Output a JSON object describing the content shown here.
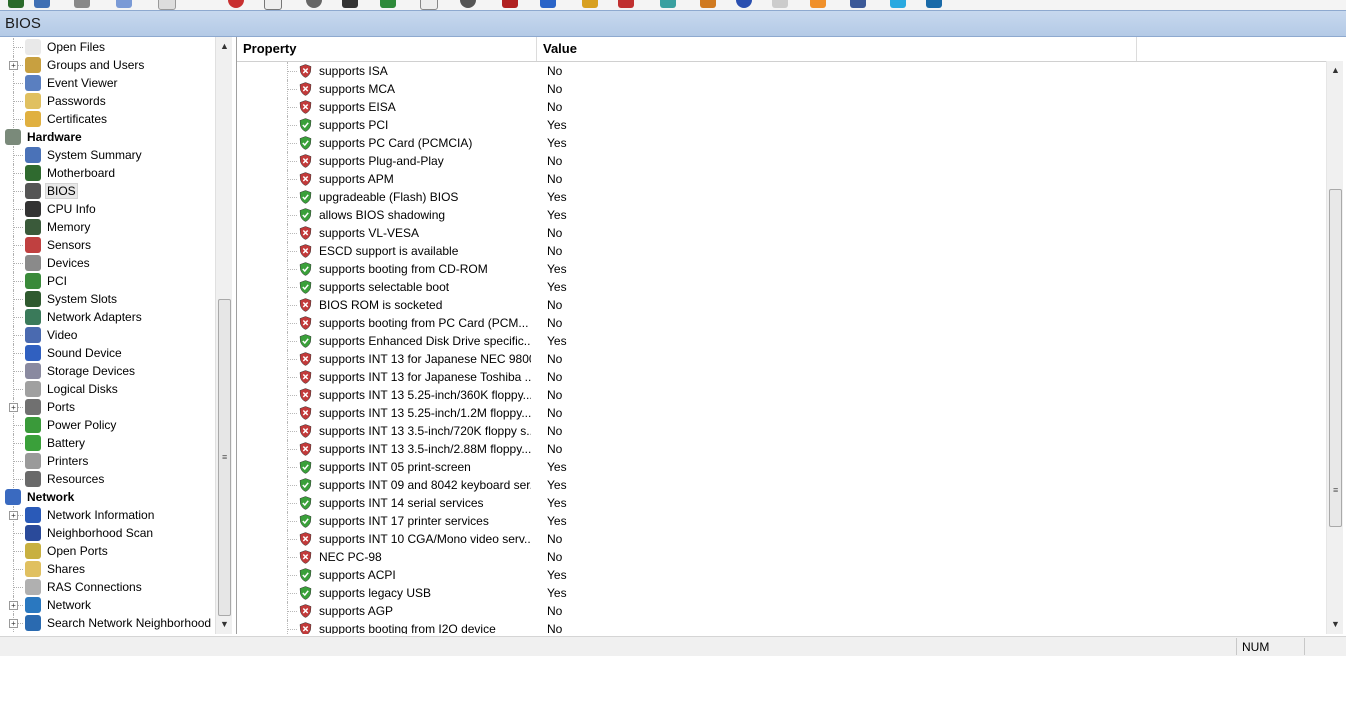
{
  "window": {
    "title": "BIOS"
  },
  "tree": {
    "items": [
      {
        "label": "Open Files",
        "icon": "file-icon",
        "kind": "child",
        "expander": false
      },
      {
        "label": "Groups and Users",
        "icon": "users-icon",
        "kind": "child",
        "expander": true
      },
      {
        "label": "Event Viewer",
        "icon": "event-viewer-icon",
        "kind": "child",
        "expander": false
      },
      {
        "label": "Passwords",
        "icon": "passwords-icon",
        "kind": "child",
        "expander": false
      },
      {
        "label": "Certificates",
        "icon": "certificate-icon",
        "kind": "child",
        "expander": false
      },
      {
        "label": "Hardware",
        "icon": "hardware-icon",
        "kind": "category",
        "expander": false
      },
      {
        "label": "System Summary",
        "icon": "monitor-icon",
        "kind": "child",
        "expander": false
      },
      {
        "label": "Motherboard",
        "icon": "motherboard-icon",
        "kind": "child",
        "expander": false
      },
      {
        "label": "BIOS",
        "icon": "bios-chip-icon",
        "kind": "child",
        "expander": false,
        "selected": true
      },
      {
        "label": "CPU Info",
        "icon": "cpu-icon",
        "kind": "child",
        "expander": false
      },
      {
        "label": "Memory",
        "icon": "memory-icon",
        "kind": "child",
        "expander": false
      },
      {
        "label": "Sensors",
        "icon": "sensor-icon",
        "kind": "child",
        "expander": false
      },
      {
        "label": "Devices",
        "icon": "devices-icon",
        "kind": "child",
        "expander": false
      },
      {
        "label": "PCI",
        "icon": "pci-icon",
        "kind": "child",
        "expander": false
      },
      {
        "label": "System Slots",
        "icon": "slots-icon",
        "kind": "child",
        "expander": false
      },
      {
        "label": "Network Adapters",
        "icon": "network-adapter-icon",
        "kind": "child",
        "expander": false
      },
      {
        "label": "Video",
        "icon": "video-icon",
        "kind": "child",
        "expander": false
      },
      {
        "label": "Sound Device",
        "icon": "sound-icon",
        "kind": "child",
        "expander": false
      },
      {
        "label": "Storage Devices",
        "icon": "storage-icon",
        "kind": "child",
        "expander": false
      },
      {
        "label": "Logical Disks",
        "icon": "disk-icon",
        "kind": "child",
        "expander": false
      },
      {
        "label": "Ports",
        "icon": "ports-icon",
        "kind": "child",
        "expander": true
      },
      {
        "label": "Power Policy",
        "icon": "power-icon",
        "kind": "child",
        "expander": false
      },
      {
        "label": "Battery",
        "icon": "battery-icon",
        "kind": "child",
        "expander": false
      },
      {
        "label": "Printers",
        "icon": "printer-icon",
        "kind": "child",
        "expander": false
      },
      {
        "label": "Resources",
        "icon": "resources-icon",
        "kind": "child",
        "expander": false
      },
      {
        "label": "Network",
        "icon": "network-icon",
        "kind": "category",
        "expander": false
      },
      {
        "label": "Network Information",
        "icon": "info-icon",
        "kind": "child",
        "expander": true
      },
      {
        "label": "Neighborhood Scan",
        "icon": "scan-icon",
        "kind": "child",
        "expander": false
      },
      {
        "label": "Open Ports",
        "icon": "open-ports-icon",
        "kind": "child",
        "expander": false
      },
      {
        "label": "Shares",
        "icon": "shares-icon",
        "kind": "child",
        "expander": false
      },
      {
        "label": "RAS Connections",
        "icon": "ras-icon",
        "kind": "child",
        "expander": false
      },
      {
        "label": "Network",
        "icon": "network-globe-icon",
        "kind": "child",
        "expander": true
      },
      {
        "label": "Search Network Neighborhood",
        "icon": "search-network-icon",
        "kind": "child",
        "expander": true
      }
    ]
  },
  "list": {
    "columns": {
      "property": "Property",
      "value": "Value"
    },
    "rows": [
      {
        "property": "supports ISA",
        "value": "No",
        "ok": false
      },
      {
        "property": "supports MCA",
        "value": "No",
        "ok": false
      },
      {
        "property": "supports EISA",
        "value": "No",
        "ok": false
      },
      {
        "property": "supports PCI",
        "value": "Yes",
        "ok": true
      },
      {
        "property": "supports PC Card (PCMCIA)",
        "value": "Yes",
        "ok": true
      },
      {
        "property": "supports Plug-and-Play",
        "value": "No",
        "ok": false
      },
      {
        "property": "supports APM",
        "value": "No",
        "ok": false
      },
      {
        "property": "upgradeable (Flash) BIOS",
        "value": "Yes",
        "ok": true
      },
      {
        "property": "allows BIOS shadowing",
        "value": "Yes",
        "ok": true
      },
      {
        "property": "supports VL-VESA",
        "value": "No",
        "ok": false
      },
      {
        "property": "ESCD support is available",
        "value": "No",
        "ok": false
      },
      {
        "property": "supports booting from CD-ROM",
        "value": "Yes",
        "ok": true
      },
      {
        "property": "supports selectable boot",
        "value": "Yes",
        "ok": true
      },
      {
        "property": "BIOS ROM is socketed",
        "value": "No",
        "ok": false
      },
      {
        "property": "supports booting from PC Card (PCM...",
        "value": "No",
        "ok": false
      },
      {
        "property": "supports Enhanced Disk Drive specific...",
        "value": "Yes",
        "ok": true
      },
      {
        "property": "supports INT 13 for Japanese NEC 9800...",
        "value": "No",
        "ok": false
      },
      {
        "property": "supports INT 13 for Japanese Toshiba ...",
        "value": "No",
        "ok": false
      },
      {
        "property": "supports INT 13 5.25-inch/360K floppy...",
        "value": "No",
        "ok": false
      },
      {
        "property": "supports INT 13 5.25-inch/1.2M floppy...",
        "value": "No",
        "ok": false
      },
      {
        "property": "supports INT 13 3.5-inch/720K floppy s...",
        "value": "No",
        "ok": false
      },
      {
        "property": "supports INT 13 3.5-inch/2.88M floppy...",
        "value": "No",
        "ok": false
      },
      {
        "property": "supports INT 05 print-screen",
        "value": "Yes",
        "ok": true
      },
      {
        "property": "supports INT 09 and 8042 keyboard ser...",
        "value": "Yes",
        "ok": true
      },
      {
        "property": "supports INT 14 serial services",
        "value": "Yes",
        "ok": true
      },
      {
        "property": "supports INT 17 printer services",
        "value": "Yes",
        "ok": true
      },
      {
        "property": "supports INT 10 CGA/Mono video serv...",
        "value": "No",
        "ok": false
      },
      {
        "property": "NEC PC-98",
        "value": "No",
        "ok": false
      },
      {
        "property": "supports ACPI",
        "value": "Yes",
        "ok": true
      },
      {
        "property": "supports legacy USB",
        "value": "Yes",
        "ok": true
      },
      {
        "property": "supports AGP",
        "value": "No",
        "ok": false
      },
      {
        "property": "supports booting from I2O device",
        "value": "No",
        "ok": false
      }
    ]
  },
  "status": {
    "num_indicator": "NUM"
  },
  "colors": {
    "ok_shield": "#3aa03a",
    "bad_shield": "#c23a3a",
    "title_band": "#bcd0ea"
  }
}
